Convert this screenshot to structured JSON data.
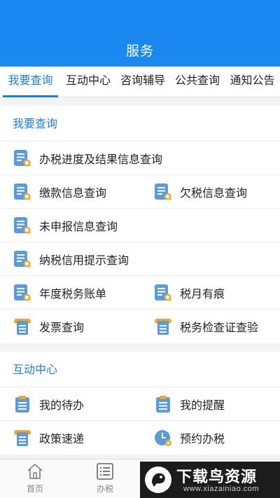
{
  "header": {
    "title": "服务"
  },
  "tabs": [
    {
      "label": "我要查询",
      "active": true
    },
    {
      "label": "互动中心",
      "active": false
    },
    {
      "label": "咨询辅导",
      "active": false
    },
    {
      "label": "公共查询",
      "active": false
    },
    {
      "label": "通知公告",
      "active": false
    }
  ],
  "query_section": {
    "title": "我要查询",
    "items": {
      "progress": "办税进度及结果信息查询",
      "payment": "缴款信息查询",
      "arrears": "欠税信息查询",
      "undeclared": "未申报信息查询",
      "credit": "纳税信用提示查询",
      "annual_bill": "年度税务账单",
      "tax_trace": "税月有痕",
      "invoice": "发票查询",
      "inspection": "税务检查证查验"
    }
  },
  "interact_section": {
    "title": "互动中心",
    "items": {
      "todo": "我的待办",
      "reminder": "我的提醒",
      "policy": "政策速递",
      "appointment": "预约办税"
    }
  },
  "bottom_nav": {
    "home": "首页",
    "tax": "办税"
  },
  "watermark": {
    "title": "下载鸟资源",
    "url": "www.xiazainiao.com"
  },
  "colors": {
    "header_blue": "#1a88f0",
    "accent_blue": "#1a7fdc",
    "icon_blue": "#5b9bd9",
    "icon_orange": "#f4a62a"
  }
}
